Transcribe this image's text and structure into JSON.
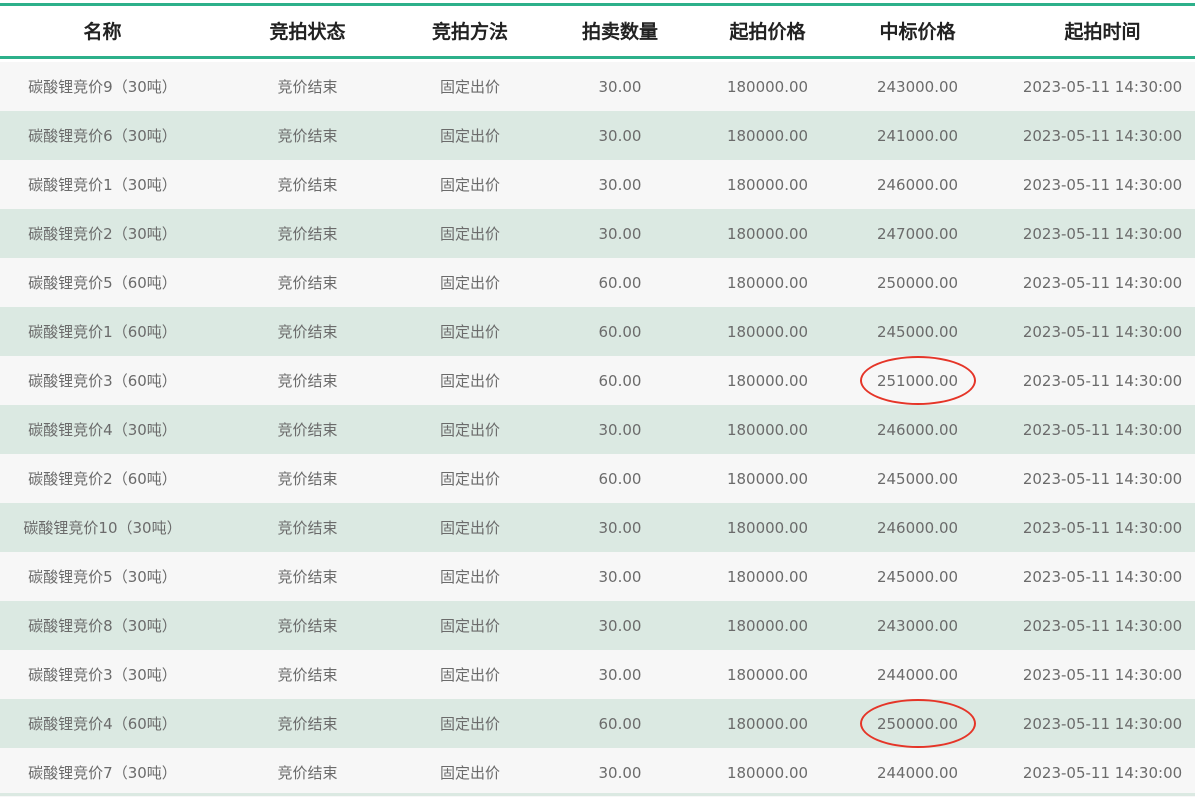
{
  "headers": {
    "name": "名称",
    "status": "竞拍状态",
    "method": "竞拍方法",
    "quantity": "拍卖数量",
    "start_price": "起拍价格",
    "winning_price": "中标价格",
    "start_time": "起拍时间"
  },
  "rows": [
    {
      "name": "碳酸锂竞价9（30吨）",
      "status": "竞价结束",
      "method": "固定出价",
      "quantity": "30.00",
      "start_price": "180000.00",
      "winning_price": "243000.00",
      "start_time": "2023-05-11 14:30:00"
    },
    {
      "name": "碳酸锂竞价6（30吨）",
      "status": "竞价结束",
      "method": "固定出价",
      "quantity": "30.00",
      "start_price": "180000.00",
      "winning_price": "241000.00",
      "start_time": "2023-05-11 14:30:00"
    },
    {
      "name": "碳酸锂竞价1（30吨）",
      "status": "竞价结束",
      "method": "固定出价",
      "quantity": "30.00",
      "start_price": "180000.00",
      "winning_price": "246000.00",
      "start_time": "2023-05-11 14:30:00"
    },
    {
      "name": "碳酸锂竞价2（30吨）",
      "status": "竞价结束",
      "method": "固定出价",
      "quantity": "30.00",
      "start_price": "180000.00",
      "winning_price": "247000.00",
      "start_time": "2023-05-11 14:30:00"
    },
    {
      "name": "碳酸锂竞价5（60吨）",
      "status": "竞价结束",
      "method": "固定出价",
      "quantity": "60.00",
      "start_price": "180000.00",
      "winning_price": "250000.00",
      "start_time": "2023-05-11 14:30:00"
    },
    {
      "name": "碳酸锂竞价1（60吨）",
      "status": "竞价结束",
      "method": "固定出价",
      "quantity": "60.00",
      "start_price": "180000.00",
      "winning_price": "245000.00",
      "start_time": "2023-05-11 14:30:00"
    },
    {
      "name": "碳酸锂竞价3（60吨）",
      "status": "竞价结束",
      "method": "固定出价",
      "quantity": "60.00",
      "start_price": "180000.00",
      "winning_price": "251000.00",
      "start_time": "2023-05-11 14:30:00",
      "circled": true
    },
    {
      "name": "碳酸锂竞价4（30吨）",
      "status": "竞价结束",
      "method": "固定出价",
      "quantity": "30.00",
      "start_price": "180000.00",
      "winning_price": "246000.00",
      "start_time": "2023-05-11 14:30:00"
    },
    {
      "name": "碳酸锂竞价2（60吨）",
      "status": "竞价结束",
      "method": "固定出价",
      "quantity": "60.00",
      "start_price": "180000.00",
      "winning_price": "245000.00",
      "start_time": "2023-05-11 14:30:00"
    },
    {
      "name": "碳酸锂竞价10（30吨）",
      "status": "竞价结束",
      "method": "固定出价",
      "quantity": "30.00",
      "start_price": "180000.00",
      "winning_price": "246000.00",
      "start_time": "2023-05-11 14:30:00"
    },
    {
      "name": "碳酸锂竞价5（30吨）",
      "status": "竞价结束",
      "method": "固定出价",
      "quantity": "30.00",
      "start_price": "180000.00",
      "winning_price": "245000.00",
      "start_time": "2023-05-11 14:30:00"
    },
    {
      "name": "碳酸锂竞价8（30吨）",
      "status": "竞价结束",
      "method": "固定出价",
      "quantity": "30.00",
      "start_price": "180000.00",
      "winning_price": "243000.00",
      "start_time": "2023-05-11 14:30:00"
    },
    {
      "name": "碳酸锂竞价3（30吨）",
      "status": "竞价结束",
      "method": "固定出价",
      "quantity": "30.00",
      "start_price": "180000.00",
      "winning_price": "244000.00",
      "start_time": "2023-05-11 14:30:00"
    },
    {
      "name": "碳酸锂竞价4（60吨）",
      "status": "竞价结束",
      "method": "固定出价",
      "quantity": "60.00",
      "start_price": "180000.00",
      "winning_price": "250000.00",
      "start_time": "2023-05-11 14:30:00",
      "circled": true
    },
    {
      "name": "碳酸锂竞价7（30吨）",
      "status": "竞价结束",
      "method": "固定出价",
      "quantity": "30.00",
      "start_price": "180000.00",
      "winning_price": "244000.00",
      "start_time": "2023-05-11 14:30:00"
    }
  ],
  "colors": {
    "accent": "#2db08a",
    "row_odd": "#f7f7f7",
    "row_even": "#dbe9e2",
    "annotation": "#e53528"
  }
}
